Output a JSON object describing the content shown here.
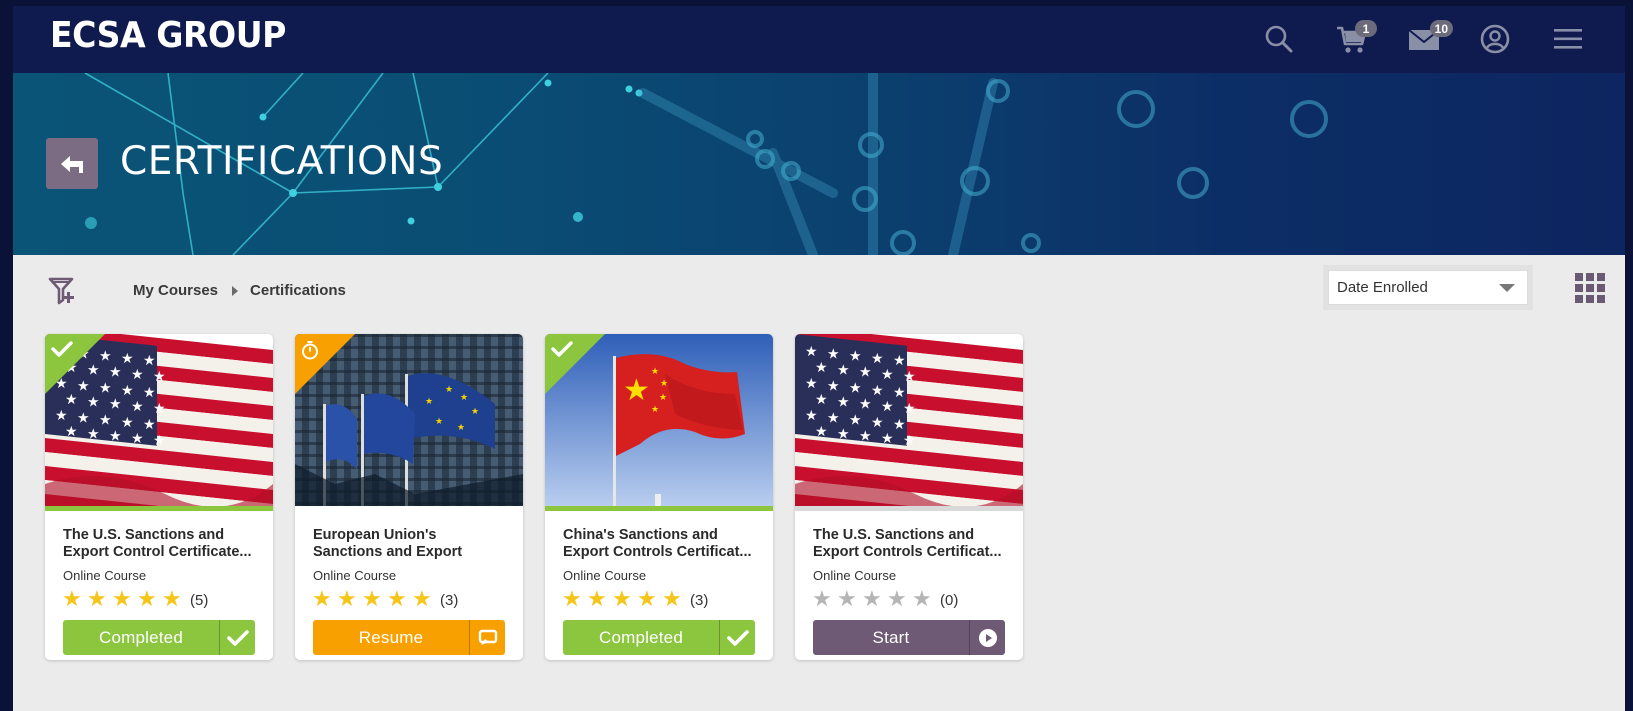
{
  "header": {
    "logo": "ECSA GROUP",
    "cart_count": "1",
    "messages_count": "10"
  },
  "icons": {
    "search": "search-icon",
    "cart": "cart-icon",
    "messages": "mail-icon",
    "account": "user-circle-icon",
    "menu": "hamburger-menu-icon"
  },
  "hero": {
    "title": "CERTIFICATIONS"
  },
  "breadcrumb": {
    "parent": "My Courses",
    "current": "Certifications"
  },
  "sort": {
    "selected": "Date Enrolled"
  },
  "colors": {
    "completed": "#8cc63f",
    "in_progress": "#f7a000",
    "start": "#6e5a74",
    "star_filled": "#f5c518",
    "star_empty": "#b5b5b5",
    "topbar": "#0f1a4e"
  },
  "courses": [
    {
      "title": "The U.S. Sanctions and Export Control Certificate...",
      "type": "Online Course",
      "rating": 5,
      "rating_count": "(5)",
      "status": "completed",
      "action_label": "Completed"
    },
    {
      "title": "European Union's Sanctions and Export Controls...",
      "type": "Online Course",
      "rating": 5,
      "rating_count": "(3)",
      "status": "in-progress",
      "action_label": "Resume"
    },
    {
      "title": "China's Sanctions and Export Controls Certificat...",
      "type": "Online Course",
      "rating": 5,
      "rating_count": "(3)",
      "status": "completed",
      "action_label": "Completed"
    },
    {
      "title": "The U.S. Sanctions and Export Controls Certificat...",
      "type": "Online Course",
      "rating": 0,
      "rating_count": "(0)",
      "status": "not-started",
      "action_label": "Start"
    }
  ]
}
